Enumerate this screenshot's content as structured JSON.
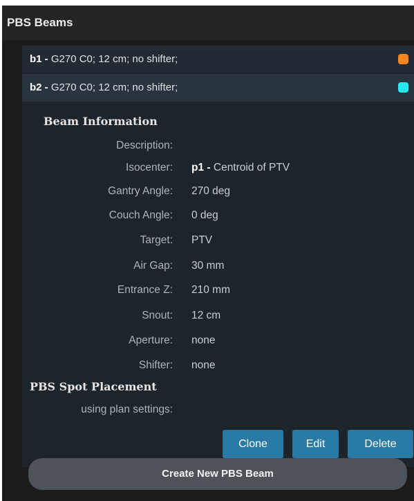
{
  "panel": {
    "title": "PBS Beams"
  },
  "beams": [
    {
      "id": "b1 -",
      "summary": "G270 C0; 12 cm; no shifter;",
      "color": "#f5861f"
    },
    {
      "id": "b2 -",
      "summary": "G270 C0; 12 cm; no shifter;",
      "color": "#27e7f2"
    }
  ],
  "beam_info": {
    "title": "Beam Information",
    "rows": [
      {
        "label": "Description:",
        "value": ""
      },
      {
        "label": "Isocenter:",
        "value_bold": "p1 -",
        "value": "Centroid of PTV"
      },
      {
        "label": "Gantry Angle:",
        "value": "270 deg"
      },
      {
        "label": "Couch Angle:",
        "value": "0 deg"
      },
      {
        "label": "Target:",
        "value": "PTV"
      },
      {
        "label": "Air Gap:",
        "value": "30 mm"
      },
      {
        "label": "Entrance Z:",
        "value": "210 mm"
      },
      {
        "label": "Snout:",
        "value": "12 cm"
      },
      {
        "label": "Aperture:",
        "value": "none"
      },
      {
        "label": "Shifter:",
        "value": "none"
      }
    ]
  },
  "spot_placement": {
    "title": "PBS Spot Placement",
    "label": "using plan settings:"
  },
  "actions": {
    "clone": "Clone",
    "edit": "Edit",
    "delete": "Delete",
    "create": "Create New PBS Beam"
  }
}
